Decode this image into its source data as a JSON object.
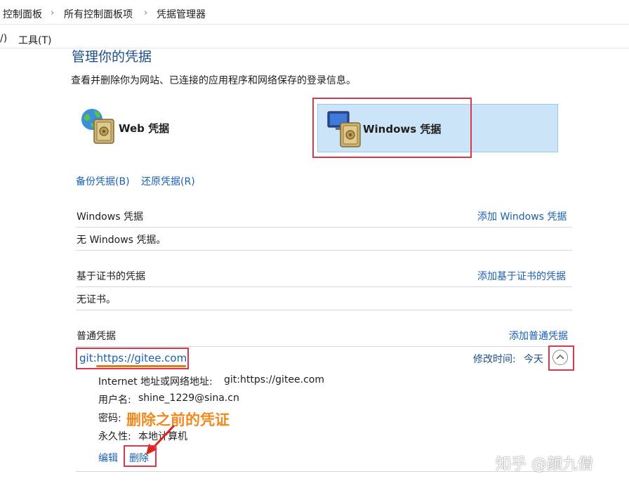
{
  "breadcrumb": {
    "items": [
      "控制面板",
      "所有控制面板项",
      "凭据管理器"
    ],
    "separator": "›"
  },
  "menu": {
    "partial_left": "/)",
    "tools": "工具(T)"
  },
  "page": {
    "title": "管理你的凭据",
    "description": "查看并删除你为网站、已连接的应用程序和网络保存的登录信息。"
  },
  "tiles": {
    "web": "Web 凭据",
    "windows": "Windows 凭据"
  },
  "actions": {
    "backup": "备份凭据(B)",
    "restore": "还原凭据(R)"
  },
  "sections": {
    "windows": {
      "title": "Windows 凭据",
      "add": "添加 Windows 凭据",
      "empty": "无 Windows 凭据。"
    },
    "cert": {
      "title": "基于证书的凭据",
      "add": "添加基于证书的凭据",
      "empty": "无证书。"
    },
    "generic": {
      "title": "普通凭据",
      "add": "添加普通凭据"
    }
  },
  "credential": {
    "name": "git:https://gitee.com",
    "modified_label": "修改时间:",
    "modified_value": "今天",
    "address_label": "Internet 地址或网络地址:",
    "address_value": "git:https://gitee.com",
    "username_label": "用户名:",
    "username_value": "shine_1229@sina.cn",
    "password_label": "密码:",
    "password_value": "",
    "persistence_label": "永久性:",
    "persistence_value": "本地计算机",
    "edit": "编辑",
    "delete": "删除"
  },
  "annotation": {
    "text": "删除之前的凭证",
    "color": "#f08a1e"
  },
  "watermark": "知乎 @颜九僧",
  "colors": {
    "link": "#1a5fb4",
    "highlight_box": "#d9364f",
    "selected_tile_bg": "#cce4f7",
    "selected_tile_border": "#99c9ef"
  }
}
